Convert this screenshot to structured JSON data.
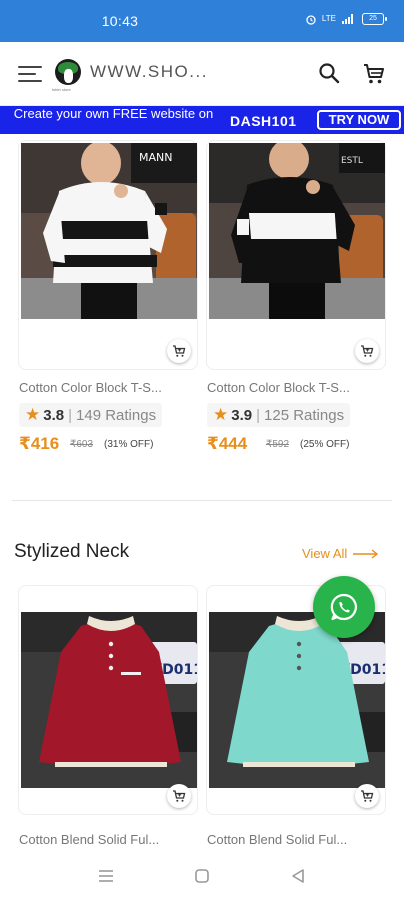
{
  "status_bar": {
    "time": "10:43",
    "battery": "25",
    "net_label": "LTE"
  },
  "header": {
    "site_name": "WWW.SHO...",
    "logo_subtext": "tshirt store"
  },
  "promo": {
    "text": "Create your own FREE website on",
    "code": "DASH101",
    "cta": "TRY NOW"
  },
  "products_top": [
    {
      "title": "Cotton Color Block T-S...",
      "rating": "3.8",
      "ratings_count": "149 Ratings",
      "price": "₹416",
      "mrp": "₹603",
      "discount": "(31% OFF)"
    },
    {
      "title": "Cotton Color Block T-S...",
      "rating": "3.9",
      "ratings_count": "125 Ratings",
      "price": "₹444",
      "mrp": "₹592",
      "discount": "(25% OFF)"
    }
  ],
  "section": {
    "title": "Stylized Neck",
    "view_all": "View All"
  },
  "products_bottom": [
    {
      "title": "Cotton Blend Solid Ful...",
      "shirt_color": "#a3172a"
    },
    {
      "title": "Cotton Blend Solid Ful...",
      "shirt_color": "#7fd8cc"
    }
  ],
  "colors": {
    "status_bar": "#2f80d8",
    "promo": "#1a23e8",
    "accent": "#e88e1a",
    "whatsapp": "#28b44a"
  },
  "icons": [
    "menu-icon",
    "search-icon",
    "cart-icon",
    "add-to-cart-icon",
    "star-icon",
    "arrow-right-icon",
    "whatsapp-icon",
    "recents-icon",
    "home-icon",
    "back-icon"
  ]
}
